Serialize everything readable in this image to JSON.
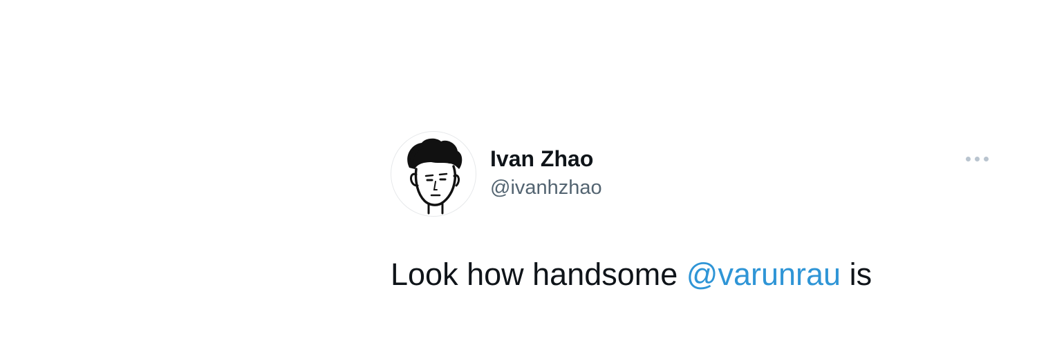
{
  "tweet": {
    "author": {
      "display_name": "Ivan Zhao",
      "handle": "@ivanhzhao",
      "avatar_icon": "cartoon-face-avatar-icon"
    },
    "more_icon": "more-horizontal-icon",
    "text": {
      "before": "Look how handsome ",
      "mention": "@varunrau",
      "after": " is"
    }
  },
  "colors": {
    "text_primary": "#0f1419",
    "text_secondary": "#536471",
    "mention": "#2f95d6",
    "more_dots": "#b9c4cf"
  }
}
